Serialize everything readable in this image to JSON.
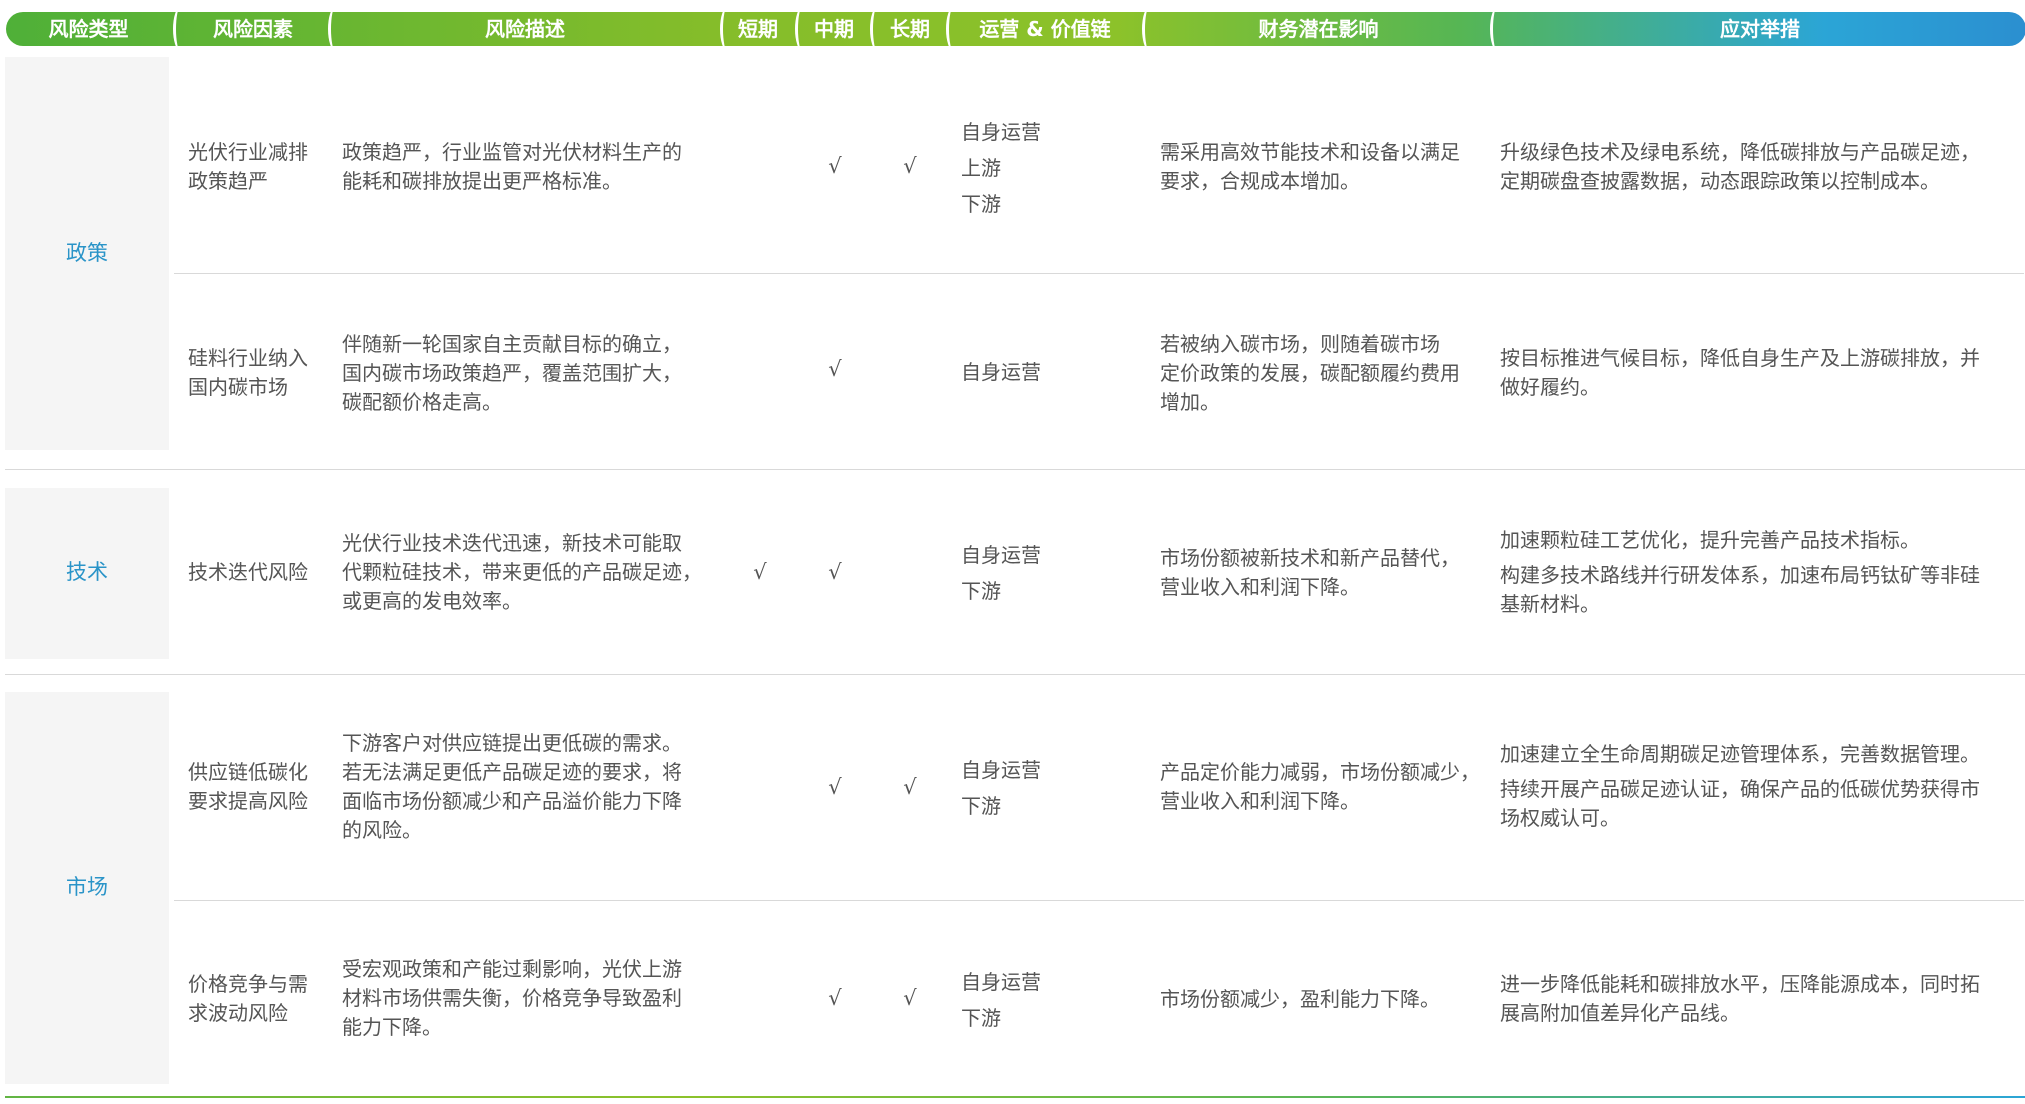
{
  "header": {
    "type": "风险类型",
    "factor": "风险因素",
    "desc": "风险描述",
    "short": "短期",
    "mid": "中期",
    "long": "长期",
    "chain": "运营 & 价值链",
    "finance": "财务潜在影响",
    "response": "应对举措"
  },
  "types": [
    "政策",
    "技术",
    "市场"
  ],
  "check_mark": "√",
  "rows": [
    {
      "factor": [
        "光伏行业减排",
        "政策趋严"
      ],
      "desc": [
        "政策趋严，行业监管对光伏材料生产的",
        "能耗和碳排放提出更严格标准。"
      ],
      "short": false,
      "mid": true,
      "long": true,
      "chain": [
        "自身运营",
        "上游",
        "下游"
      ],
      "finance": [
        "需采用高效节能技术和设备以满足",
        "要求，合规成本增加。"
      ],
      "response": [
        [
          "升级绿色技术及绿电系统，降低碳排放与产品碳足迹，",
          "定期碳盘查披露数据，动态跟踪政策以控制成本。"
        ]
      ]
    },
    {
      "factor": [
        "硅料行业纳入",
        "国内碳市场"
      ],
      "desc": [
        "伴随新一轮国家自主贡献目标的确立，",
        "国内碳市场政策趋严，覆盖范围扩大，",
        "碳配额价格走高。"
      ],
      "short": false,
      "mid": true,
      "long": false,
      "chain": [
        "自身运营"
      ],
      "finance": [
        "若被纳入碳市场，则随着碳市场",
        "定价政策的发展，碳配额履约费用",
        "增加。"
      ],
      "response": [
        [
          "按目标推进气候目标，降低自身生产及上游碳排放，并",
          "做好履约。"
        ]
      ]
    },
    {
      "factor": [
        "技术迭代风险"
      ],
      "desc": [
        "光伏行业技术迭代迅速，新技术可能取",
        "代颗粒硅技术，带来更低的产品碳足迹，",
        "或更高的发电效率。"
      ],
      "short": true,
      "mid": true,
      "long": false,
      "chain": [
        "自身运营",
        "下游"
      ],
      "finance": [
        "市场份额被新技术和新产品替代，",
        "营业收入和利润下降。"
      ],
      "response": [
        [
          "加速颗粒硅工艺优化，提升完善产品技术指标。"
        ],
        [
          "构建多技术路线并行研发体系，加速布局钙钛矿等非硅",
          "基新材料。"
        ]
      ]
    },
    {
      "factor": [
        "供应链低碳化",
        "要求提高风险"
      ],
      "desc": [
        "下游客户对供应链提出更低碳的需求。",
        "若无法满足更低产品碳足迹的要求，将",
        "面临市场份额减少和产品溢价能力下降",
        "的风险。"
      ],
      "short": false,
      "mid": true,
      "long": true,
      "chain": [
        "自身运营",
        "下游"
      ],
      "finance": [
        "产品定价能力减弱，市场份额减少，",
        "营业收入和利润下降。"
      ],
      "response": [
        [
          "加速建立全生命周期碳足迹管理体系，完善数据管理。"
        ],
        [
          "持续开展产品碳足迹认证，确保产品的低碳优势获得市",
          "场权威认可。"
        ]
      ]
    },
    {
      "factor": [
        "价格竞争与需",
        "求波动风险"
      ],
      "desc": [
        "受宏观政策和产能过剩影响，光伏上游",
        "材料市场供需失衡，价格竞争导致盈利",
        "能力下降。"
      ],
      "short": false,
      "mid": true,
      "long": true,
      "chain": [
        "自身运营",
        "下游"
      ],
      "finance": [
        "市场份额减少，盈利能力下降。"
      ],
      "response": [
        [
          "进一步降低能耗和碳排放水平，压降能源成本，同时拓",
          "展高附加值差异化产品线。"
        ]
      ]
    }
  ]
}
